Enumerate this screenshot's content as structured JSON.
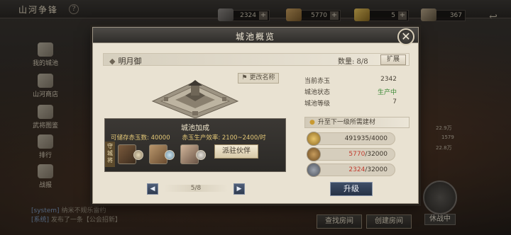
{
  "app": {
    "title": "山河争锋",
    "help": "?"
  },
  "resources": [
    {
      "name": "resource-1",
      "value": "2324"
    },
    {
      "name": "resource-2",
      "value": "5770"
    },
    {
      "name": "resource-3",
      "value": "5"
    },
    {
      "name": "resource-4",
      "value": "367"
    }
  ],
  "sidebar": {
    "items": [
      {
        "label": "我的城池",
        "icon": "city-icon"
      },
      {
        "label": "山河商店",
        "icon": "shop-icon"
      },
      {
        "label": "武将图鉴",
        "icon": "book-icon"
      },
      {
        "label": "排行",
        "icon": "rank-icon"
      },
      {
        "label": "战报",
        "icon": "report-icon"
      }
    ]
  },
  "chat": {
    "lines": [
      {
        "tag": "[system]",
        "text": "纳米不规乐雷约"
      },
      {
        "tag": "[系统]",
        "text": "发布了一条【公会招新】"
      }
    ]
  },
  "bottom": {
    "find_room": "查找房间",
    "create_room": "创建房间",
    "battle_status": "休战中",
    "side_numbers": [
      "22.9万",
      "1579",
      "22.8万"
    ]
  },
  "modal": {
    "title": "城池概览",
    "close": "✕",
    "city_name": "明月御",
    "quantity": "数量: 8/8",
    "expand": "扩展",
    "rename": "更改名称",
    "bonus": {
      "title": "城池加成",
      "storage": "可储存赤玉数: 40000",
      "production": "赤玉生产效率: 2100~2400/时"
    },
    "garrison_tag": "守城将",
    "dispatch": "派驻伙伴",
    "stats": [
      {
        "label": "当前赤玉",
        "value": "2342"
      },
      {
        "label": "城池状态",
        "value": "生产中"
      },
      {
        "label": "城池等级",
        "value": "7"
      }
    ],
    "upgrade_header": "升至下一级所需建材",
    "materials": [
      {
        "icon": "coin-icon",
        "have": "491935",
        "need": "4000"
      },
      {
        "icon": "wood-icon",
        "have": "5770",
        "need": "32000"
      },
      {
        "icon": "iron-icon",
        "have": "2324",
        "need": "32000"
      }
    ],
    "page": "5/8",
    "prev": "◀",
    "next": "▶",
    "upgrade": "升级"
  },
  "colors": {
    "accent_gold": "#e5c978",
    "status_green": "#3c8a37",
    "shortage_red": "#c23b2d",
    "button_blue": "#2f3b50"
  }
}
